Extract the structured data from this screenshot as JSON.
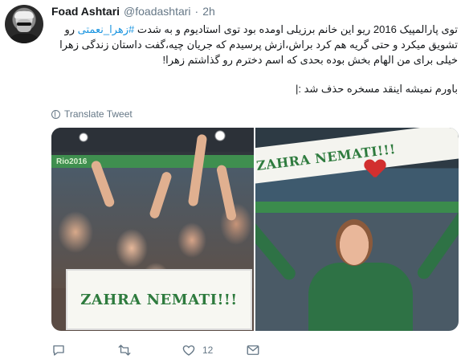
{
  "tweet": {
    "author_name": "Foad Ashtari",
    "author_handle": "@foadashtari",
    "separator": "·",
    "time": "2h",
    "text_line1": "توی پارالمپیک 2016 ریو این خانم برزیلی اومده بود توی استادیوم و به شدت ",
    "hashtag": "#زهرا_نعمتی",
    "text_line1_rest": " رو تشویق میکرد و حتی گریه هم کرد براش،ازش پرسیدم که جریان چیه،گفت داستان زندگی زهرا خیلی برای من الهام بخش بوده بحدی که اسم دخترم رو گذاشتم زهرا!",
    "text_line2": "باورم نمیشه اینقد مسخره حذف شد :|",
    "translate_label": "Translate Tweet"
  },
  "photos": {
    "left_sign_text": "ZAHRA NEMATI!!!",
    "left_board_text": "Rio2016",
    "right_banner_text": "ZAHRA NEMATI!!!"
  },
  "actions": {
    "reply_icon": "reply-icon",
    "retweet_icon": "retweet-icon",
    "like_icon": "heart-icon",
    "like_count": "12",
    "dm_icon": "envelope-icon"
  },
  "colors": {
    "link": "#1b95e0",
    "secondary_text": "#657786",
    "sign_green": "#2e7b3e"
  }
}
